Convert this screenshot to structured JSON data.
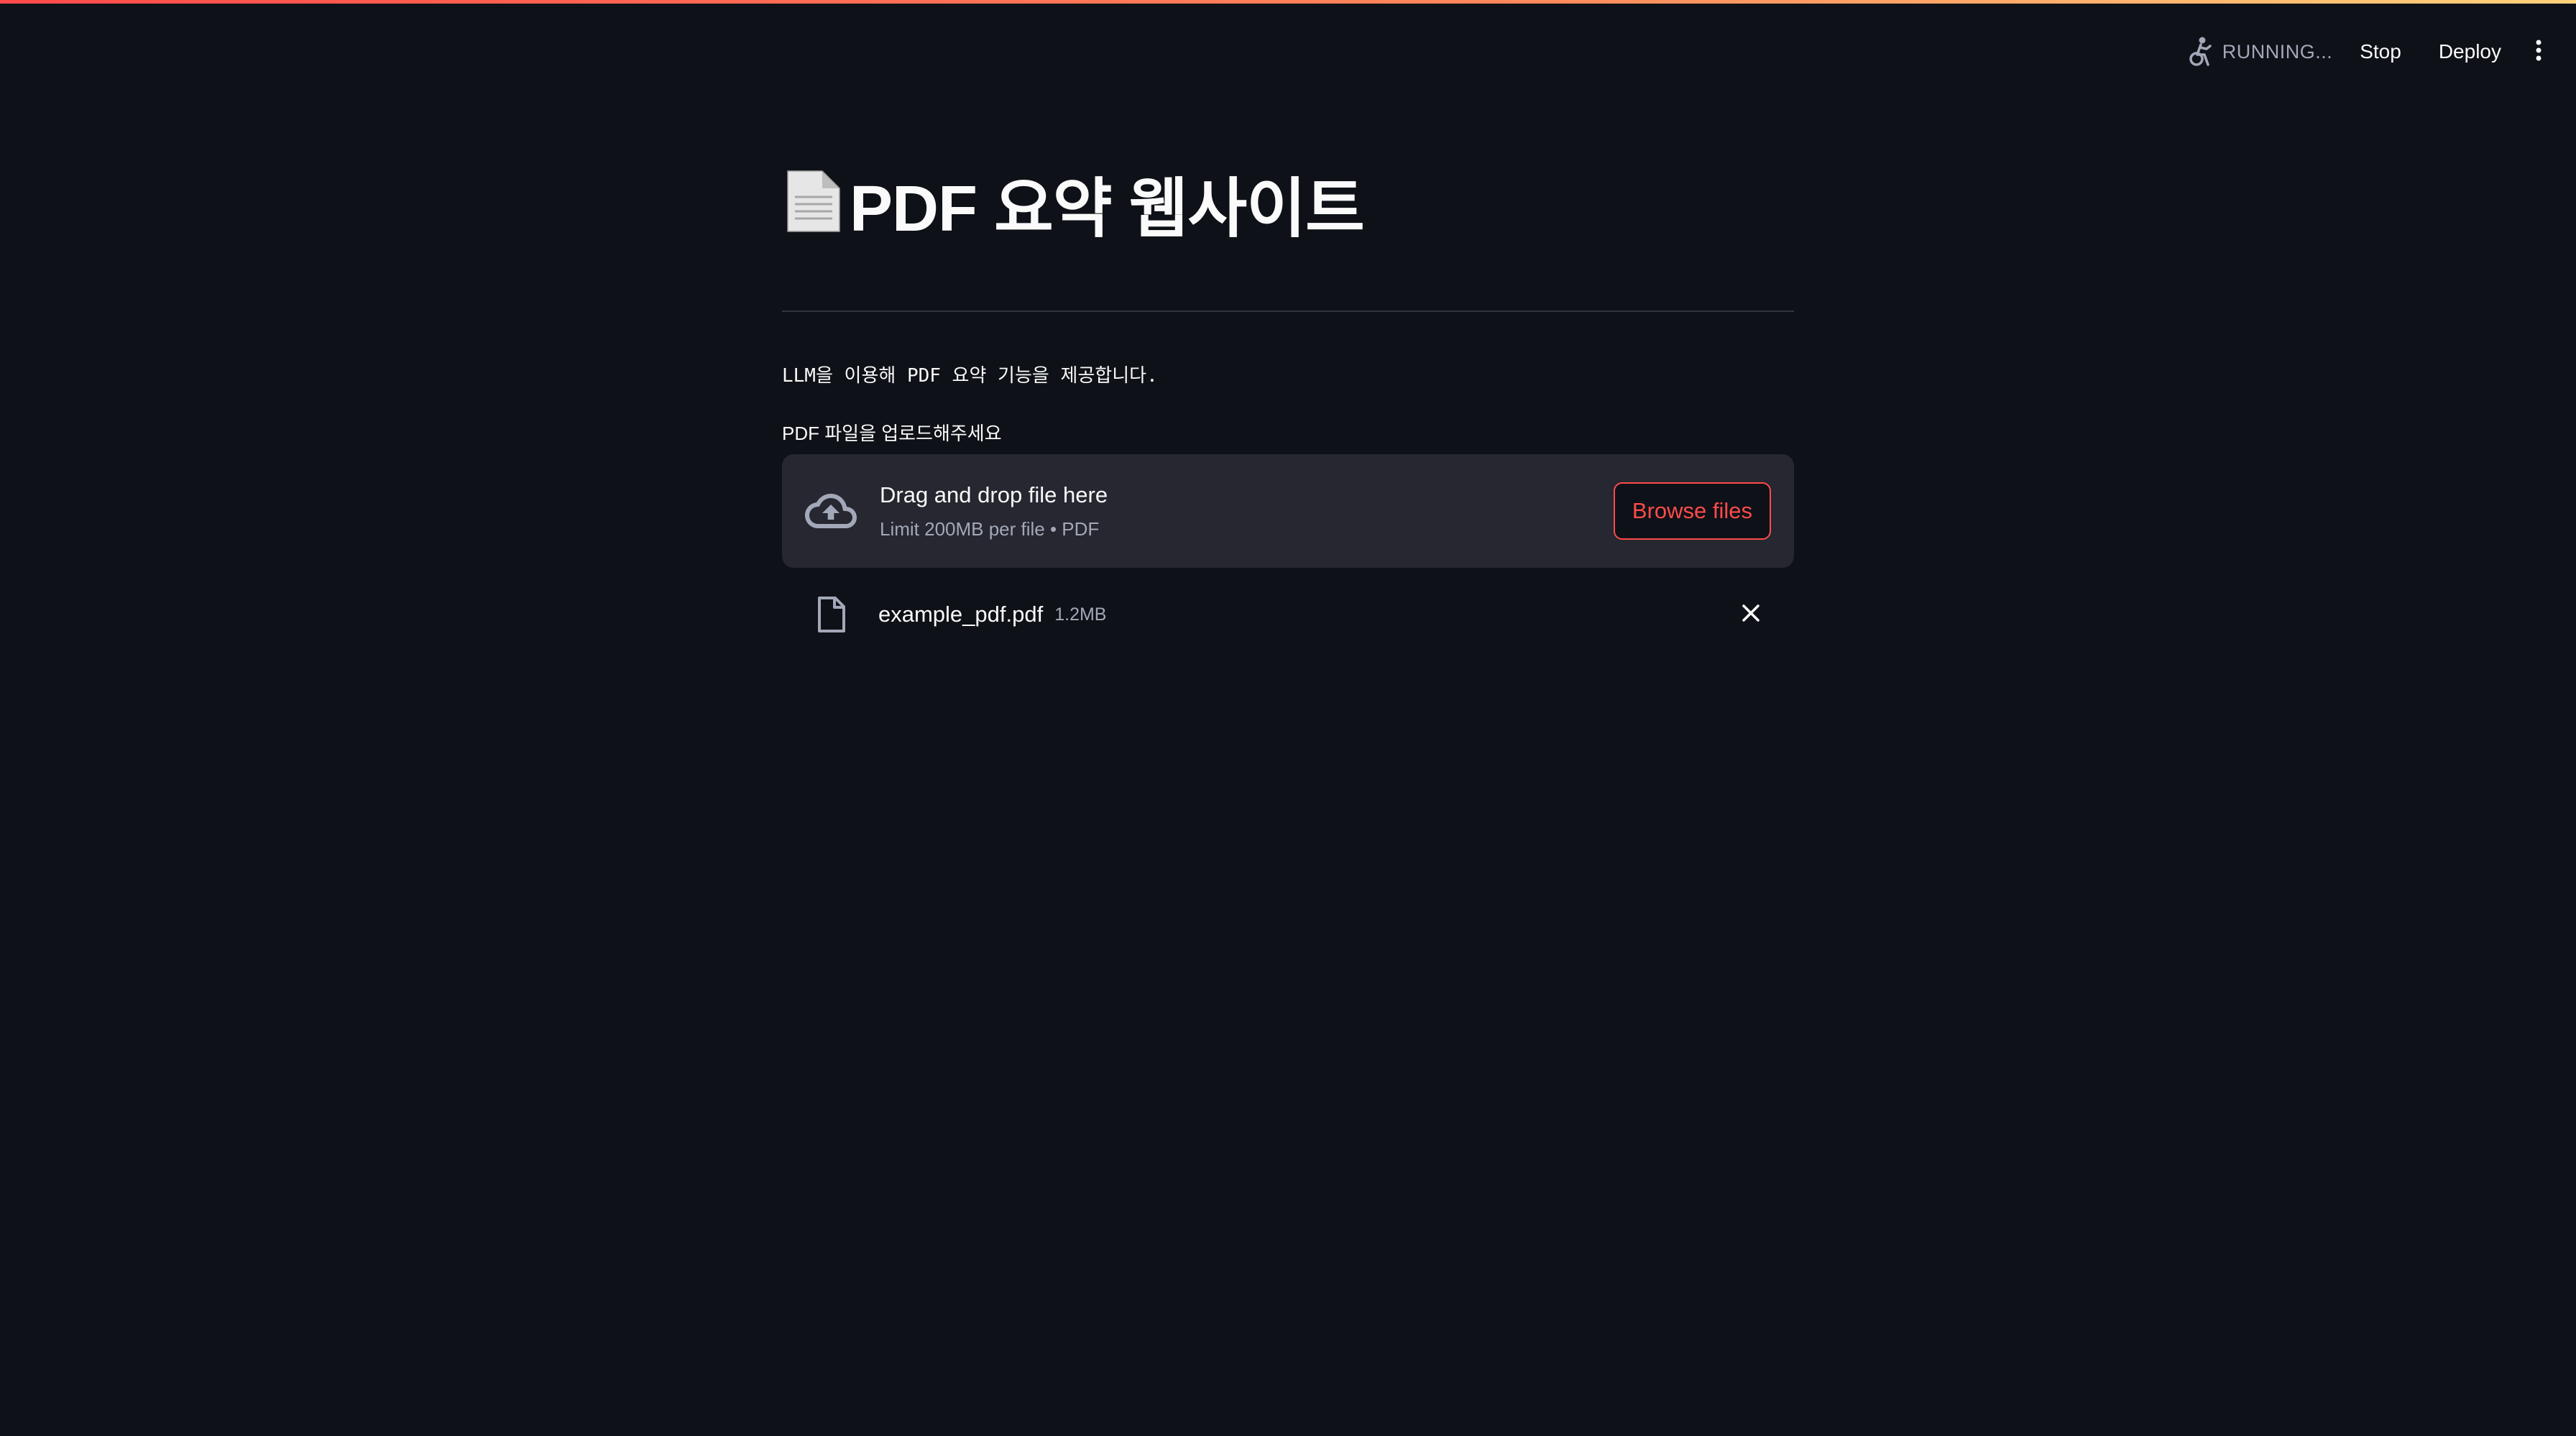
{
  "toolbar": {
    "status_text": "RUNNING...",
    "stop_label": "Stop",
    "deploy_label": "Deploy",
    "status_icon": "running-figure-icon",
    "menu_icon": "vertical-dots-icon"
  },
  "main": {
    "title": "PDF 요약 웹사이트",
    "title_icon": "page-facing-up-icon",
    "description": "LLM을 이용해 PDF 요약 기능을 제공합니다.",
    "uploader": {
      "label": "PDF 파일을 업로드해주세요",
      "drop_title": "Drag and drop file here",
      "drop_subtitle": "Limit 200MB per file • PDF",
      "browse_label": "Browse files",
      "icon": "cloud-upload-icon"
    },
    "uploaded_file": {
      "name": "example_pdf.pdf",
      "size": "1.2MB",
      "icon": "file-icon",
      "remove_icon": "close-icon"
    }
  },
  "colors": {
    "background": "#0e1117",
    "accent": "#ff4b4b",
    "dropzone": "#262730",
    "muted_text": "#a3a8b8"
  }
}
